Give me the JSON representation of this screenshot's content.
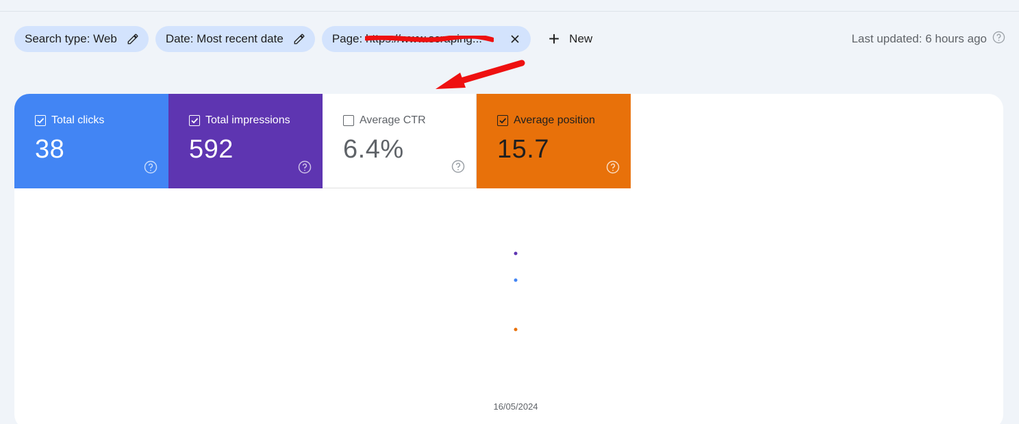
{
  "filters": {
    "search_type": "Search type: Web",
    "date": "Date: Most recent date",
    "page": "Page: https://www.scraping...",
    "new_label": "New"
  },
  "status": {
    "last_updated": "Last updated: 6 hours ago"
  },
  "metrics": [
    {
      "label": "Total clicks",
      "value": "38",
      "checked": true,
      "color": "#4285f4"
    },
    {
      "label": "Total impressions",
      "value": "592",
      "checked": true,
      "color": "#5e35b1"
    },
    {
      "label": "Average CTR",
      "value": "6.4%",
      "checked": false,
      "color": "#ffffff"
    },
    {
      "label": "Average position",
      "value": "15.7",
      "checked": true,
      "color": "#e8710a"
    }
  ],
  "chart_data": {
    "type": "scatter",
    "x": [
      "16/05/2024"
    ],
    "series": [
      {
        "values": [
          592
        ],
        "color": "#5e35b1"
      },
      {
        "values": [
          38
        ],
        "color": "#4285f4"
      },
      {
        "values": [
          15.7
        ],
        "color": "#e8710a"
      }
    ],
    "xlabel": "16/05/2024"
  },
  "colors": {
    "annotation": "#ee1111",
    "chip_bg": "#d3e3fd",
    "page_bg": "#f0f4f9"
  },
  "icons": {
    "edit": "pencil-icon",
    "close": "close-icon",
    "help": "help-circle-icon",
    "checkbox": "checkbox-icon"
  }
}
